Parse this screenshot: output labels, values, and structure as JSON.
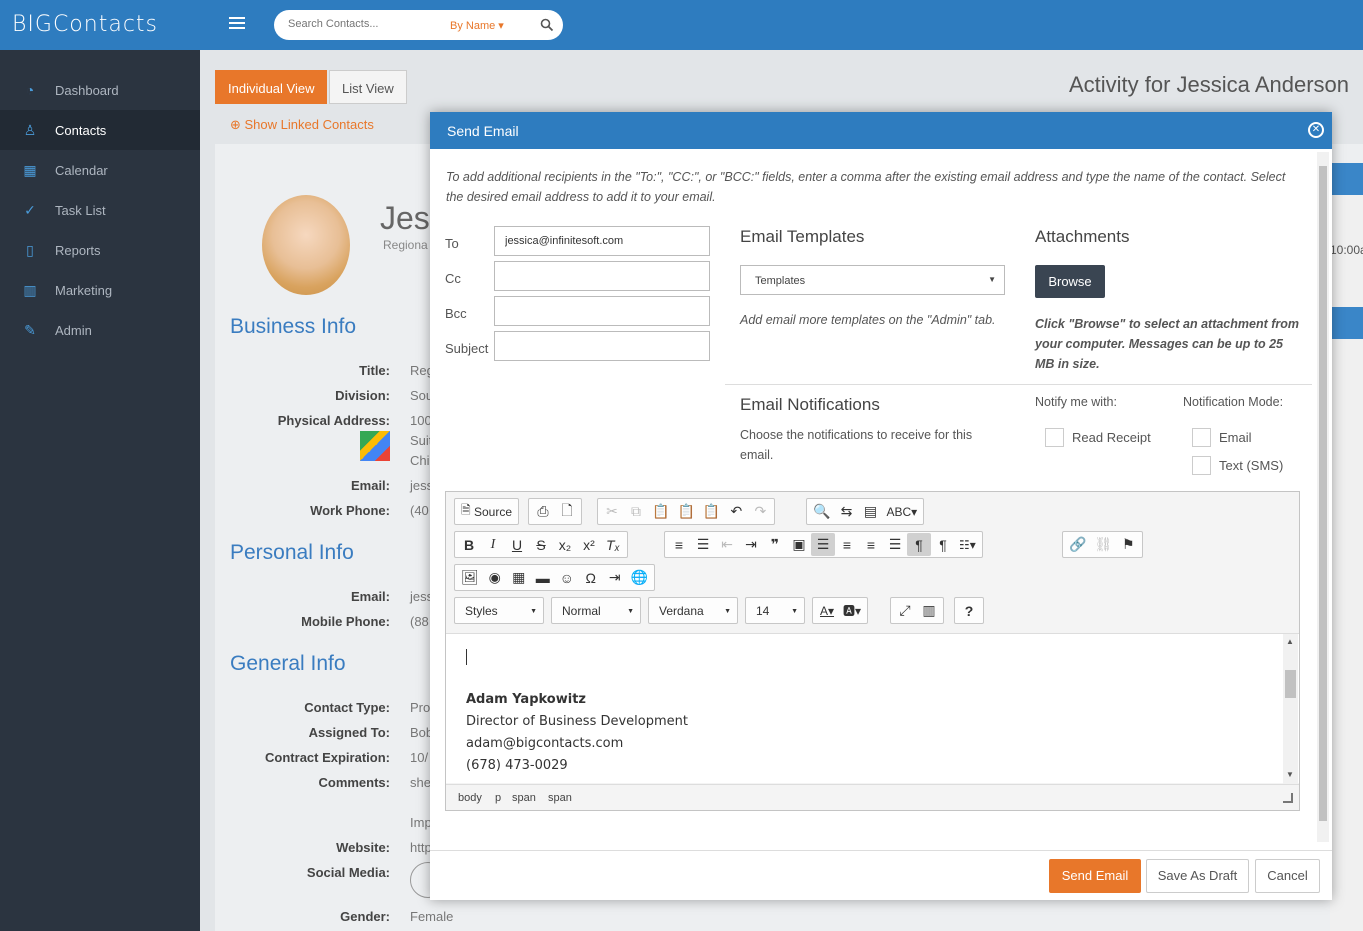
{
  "app": {
    "logo": "BIGContacts"
  },
  "search": {
    "placeholder": "Search Contacts...",
    "by_label": "By Name ▾"
  },
  "sidebar": {
    "items": [
      {
        "label": "Dashboard",
        "icon": "dashboard-icon"
      },
      {
        "label": "Contacts",
        "icon": "user-icon"
      },
      {
        "label": "Calendar",
        "icon": "calendar-icon"
      },
      {
        "label": "Task List",
        "icon": "check-circle-icon"
      },
      {
        "label": "Reports",
        "icon": "document-icon"
      },
      {
        "label": "Marketing",
        "icon": "bar-chart-icon"
      },
      {
        "label": "Admin",
        "icon": "wrench-icon"
      }
    ],
    "active_index": 1
  },
  "page": {
    "view_individual": "Individual View",
    "view_list": "List View",
    "linked_contacts": "Show Linked Contacts",
    "activity_title": "Activity for Jessica Anderson",
    "name_partial": "Jes",
    "title_partial": "Regiona",
    "time_partial": "10:00a",
    "sections": {
      "business": "Business Info",
      "personal": "Personal Info",
      "general": "General Info"
    },
    "fields": {
      "title_label": "Title:",
      "title_val": "Reg",
      "division_label": "Division:",
      "division_val": "Sou",
      "address_label": "Physical Address:",
      "address_val1": "100",
      "address_val2": "Suit",
      "address_val3": "Chi",
      "email_label": "Email:",
      "email_val": "jess",
      "work_phone_label": "Work Phone:",
      "work_phone_val": "(40",
      "p_email_label": "Email:",
      "p_email_val": "jess",
      "mobile_label": "Mobile Phone:",
      "mobile_val": "(88",
      "contact_type_label": "Contact Type:",
      "contact_type_val": "Pro",
      "assigned_label": "Assigned To:",
      "assigned_val": "Bob",
      "contract_label": "Contract Expiration:",
      "contract_val": "10/",
      "comments_label": "Comments:",
      "comments_val": "she",
      "comments_val2": "Imp",
      "website_label": "Website:",
      "website_val": "http",
      "social_label": "Social Media:",
      "gender_label": "Gender:",
      "gender_val": "Female"
    }
  },
  "modal": {
    "title": "Send Email",
    "instructions": "To add additional recipients in the \"To:\", \"CC:\", or \"BCC:\" fields, enter a comma after the existing email address and type the name of the contact. Select the desired email address to add it to your email.",
    "to_label": "To",
    "to_value": "jessica@infinitesoft.com",
    "cc_label": "Cc",
    "bcc_label": "Bcc",
    "subject_label": "Subject",
    "templates_heading": "Email Templates",
    "templates_select": "Templates",
    "templates_hint": "Add email more templates on the \"Admin\" tab.",
    "attachments_heading": "Attachments",
    "browse_label": "Browse",
    "attachments_hint": "Click \"Browse\" to select an attachment from your computer. Messages can be up to 25 MB in size.",
    "notifications_heading": "Email Notifications",
    "notifications_text": "Choose the notifications to receive for this email.",
    "notify_with_label": "Notify me with:",
    "read_receipt_label": "Read Receipt",
    "mode_label": "Notification Mode:",
    "mode_email_label": "Email",
    "mode_sms_label": "Text (SMS)",
    "editor": {
      "source_label": "Source",
      "styles": "Styles",
      "format": "Normal",
      "font": "Verdana",
      "size": "14",
      "signature": {
        "name": "Adam Yapkowitz",
        "role": "Director of Business Development",
        "email": "adam@bigcontacts.com",
        "phone": "(678) 473-0029"
      },
      "path": [
        "body",
        "p",
        "span",
        "span"
      ]
    },
    "send_label": "Send Email",
    "draft_label": "Save As Draft",
    "cancel_label": "Cancel"
  },
  "colors": {
    "brand_blue": "#2e7cbf",
    "accent_orange": "#e8772a",
    "sidebar": "#2b3440"
  }
}
